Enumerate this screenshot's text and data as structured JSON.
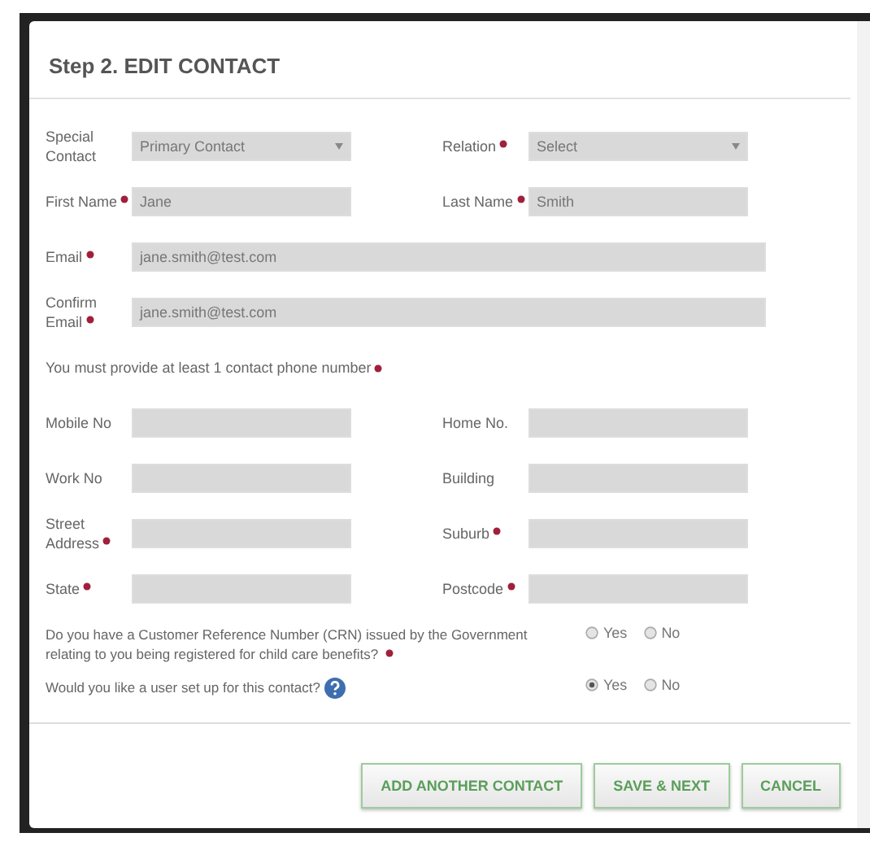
{
  "dialog": {
    "title": "Step 2. EDIT CONTACT"
  },
  "rows": [
    {
      "fields": [
        {
          "label": "Special Contact",
          "required": false,
          "kind": "select",
          "value": "Primary Contact"
        },
        {
          "label": "Relation",
          "required": true,
          "kind": "select",
          "value": "Select"
        }
      ]
    },
    {
      "fields": [
        {
          "label": "First Name",
          "required": true,
          "kind": "text",
          "value": "Jane"
        },
        {
          "label": "Last Name",
          "required": true,
          "kind": "text",
          "value": "Smith"
        }
      ]
    },
    {
      "fields": [
        {
          "label": "Email",
          "required": true,
          "kind": "wide",
          "value": "jane.smith@test.com"
        }
      ]
    },
    {
      "fields": [
        {
          "label": "Confirm Email",
          "required": true,
          "kind": "wide",
          "value": "jane.smith@test.com"
        }
      ]
    },
    {
      "note": {
        "text": "You must provide at least 1 contact phone number",
        "required": true
      }
    },
    {
      "fields": [
        {
          "label": "Mobile No",
          "required": false,
          "kind": "text"
        },
        {
          "label": "Home No.",
          "required": false,
          "kind": "text"
        }
      ]
    },
    {
      "fields": [
        {
          "label": "Work No",
          "required": false,
          "kind": "text"
        },
        {
          "label": "Building",
          "required": false,
          "kind": "text"
        }
      ]
    },
    {
      "fields": [
        {
          "label": "Street Address",
          "required": true,
          "kind": "text"
        },
        {
          "label": "Suburb",
          "required": true,
          "kind": "text"
        }
      ]
    },
    {
      "fields": [
        {
          "label": "State",
          "required": true,
          "kind": "text"
        },
        {
          "label": "Postcode",
          "required": true,
          "kind": "text"
        }
      ]
    }
  ],
  "questions": [
    {
      "text": "Do you have a Customer Reference Number (CRN) issued by the Government relating to you being registered for child care benefits?",
      "required": true,
      "help": false,
      "options": [
        {
          "label": "Yes",
          "selected": false
        },
        {
          "label": "No",
          "selected": false
        }
      ]
    },
    {
      "text": "Would you like a user set up for this contact?",
      "required": false,
      "help": true,
      "options": [
        {
          "label": "Yes",
          "selected": true
        },
        {
          "label": "No",
          "selected": false
        }
      ]
    }
  ],
  "buttons": [
    "ADD ANOTHER CONTACT",
    "SAVE & NEXT",
    "CANCEL"
  ]
}
